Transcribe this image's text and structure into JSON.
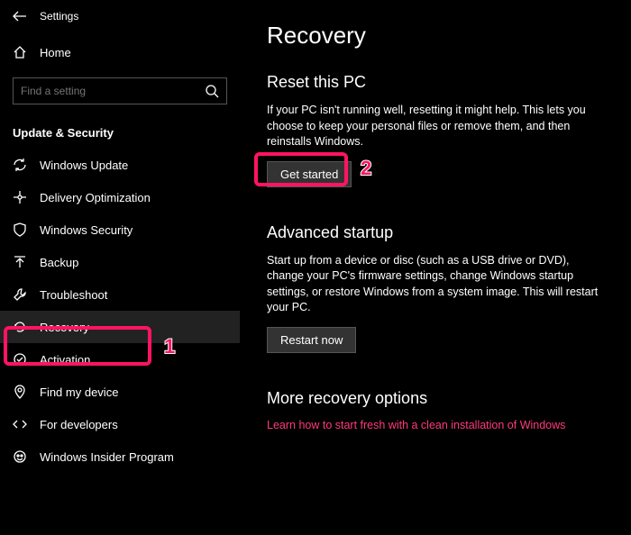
{
  "window": {
    "title": "Settings"
  },
  "sidebar": {
    "home": "Home",
    "search_placeholder": "Find a setting",
    "category": "Update & Security",
    "items": [
      {
        "label": "Windows Update"
      },
      {
        "label": "Delivery Optimization"
      },
      {
        "label": "Windows Security"
      },
      {
        "label": "Backup"
      },
      {
        "label": "Troubleshoot"
      },
      {
        "label": "Recovery"
      },
      {
        "label": "Activation"
      },
      {
        "label": "Find my device"
      },
      {
        "label": "For developers"
      },
      {
        "label": "Windows Insider Program"
      }
    ]
  },
  "main": {
    "title": "Recovery",
    "reset": {
      "heading": "Reset this PC",
      "desc": "If your PC isn't running well, resetting it might help. This lets you choose to keep your personal files or remove them, and then reinstalls Windows.",
      "button": "Get started"
    },
    "advanced": {
      "heading": "Advanced startup",
      "desc": "Start up from a device or disc (such as a USB drive or DVD), change your PC's firmware settings, change Windows startup settings, or restore Windows from a system image. This will restart your PC.",
      "button": "Restart now"
    },
    "more": {
      "heading": "More recovery options",
      "link": "Learn how to start fresh with a clean installation of Windows"
    }
  },
  "annotations": {
    "a1": "1",
    "a2": "2"
  }
}
